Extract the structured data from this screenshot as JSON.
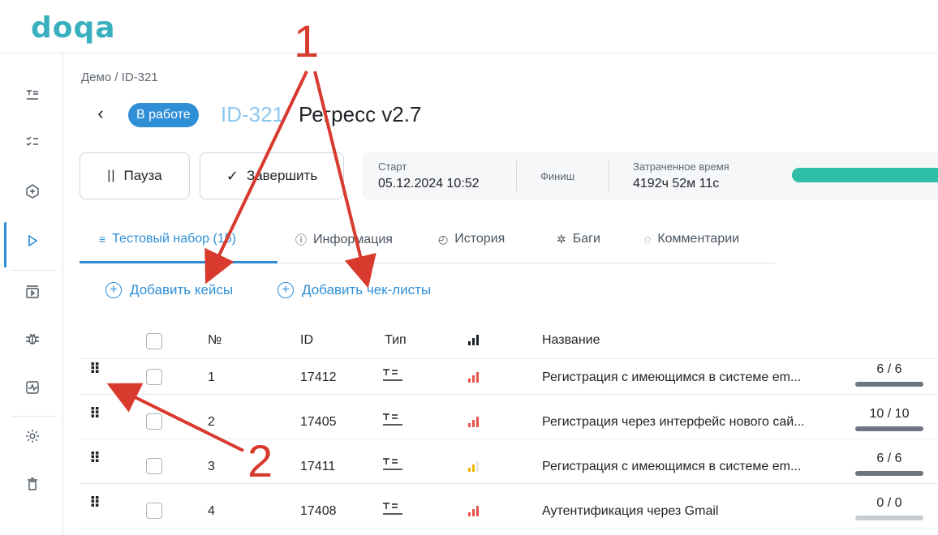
{
  "logo": "doqa",
  "breadcrumb": "Демо / ID-321",
  "status": "В работе",
  "title_id": "ID-321",
  "title_name": "Регресс v2.7",
  "actions": {
    "pause": "Пауза",
    "finish": "Завершить"
  },
  "info": {
    "start_label": "Старт",
    "start_value": "05.12.2024 10:52",
    "finish_label": "Финиш",
    "spent_label": "Затраченное время",
    "spent_value": "4192ч 52м 11с",
    "progress_color": "#2fbfa8"
  },
  "tabs": [
    {
      "label": "Тестовый набор (15)",
      "icon": "edit-list-icon",
      "active": true
    },
    {
      "label": "Информация",
      "icon": "info-icon"
    },
    {
      "label": "История",
      "icon": "history-icon"
    },
    {
      "label": "Баги",
      "icon": "bug-icon"
    },
    {
      "label": "Комментарии",
      "icon": "comment-icon"
    }
  ],
  "add_links": {
    "cases": "Добавить кейсы",
    "checklists": "Добавить чек-листы"
  },
  "table": {
    "headers": {
      "num": "№",
      "id": "ID",
      "type": "Тип",
      "name": "Название"
    },
    "rows": [
      {
        "num": "1",
        "id": "17412",
        "name": "Регистрация с имеющимся в системе em...",
        "progress": "6 / 6",
        "done": 1.0,
        "prio_color": "#e8504a"
      },
      {
        "num": "2",
        "id": "17405",
        "name": "Регистрация через интерфейс нового сай...",
        "progress": "10 / 10",
        "done": 1.0,
        "prio_color": "#e8504a"
      },
      {
        "num": "3",
        "id": "17411",
        "name": "Регистрация с имеющимся в системе em...",
        "progress": "6 / 6",
        "done": 1.0,
        "prio_color": "#f0b400"
      },
      {
        "num": "4",
        "id": "17408",
        "name": "Аутентификация через Gmail",
        "progress": "0 / 0",
        "done": 0.0,
        "prio_color": "#e8504a"
      }
    ]
  },
  "annotations": {
    "one": "1",
    "two": "2",
    "color": "#d83a2e"
  },
  "colors": {
    "accent": "#2f8fd6",
    "brand": "#3aafc0"
  }
}
